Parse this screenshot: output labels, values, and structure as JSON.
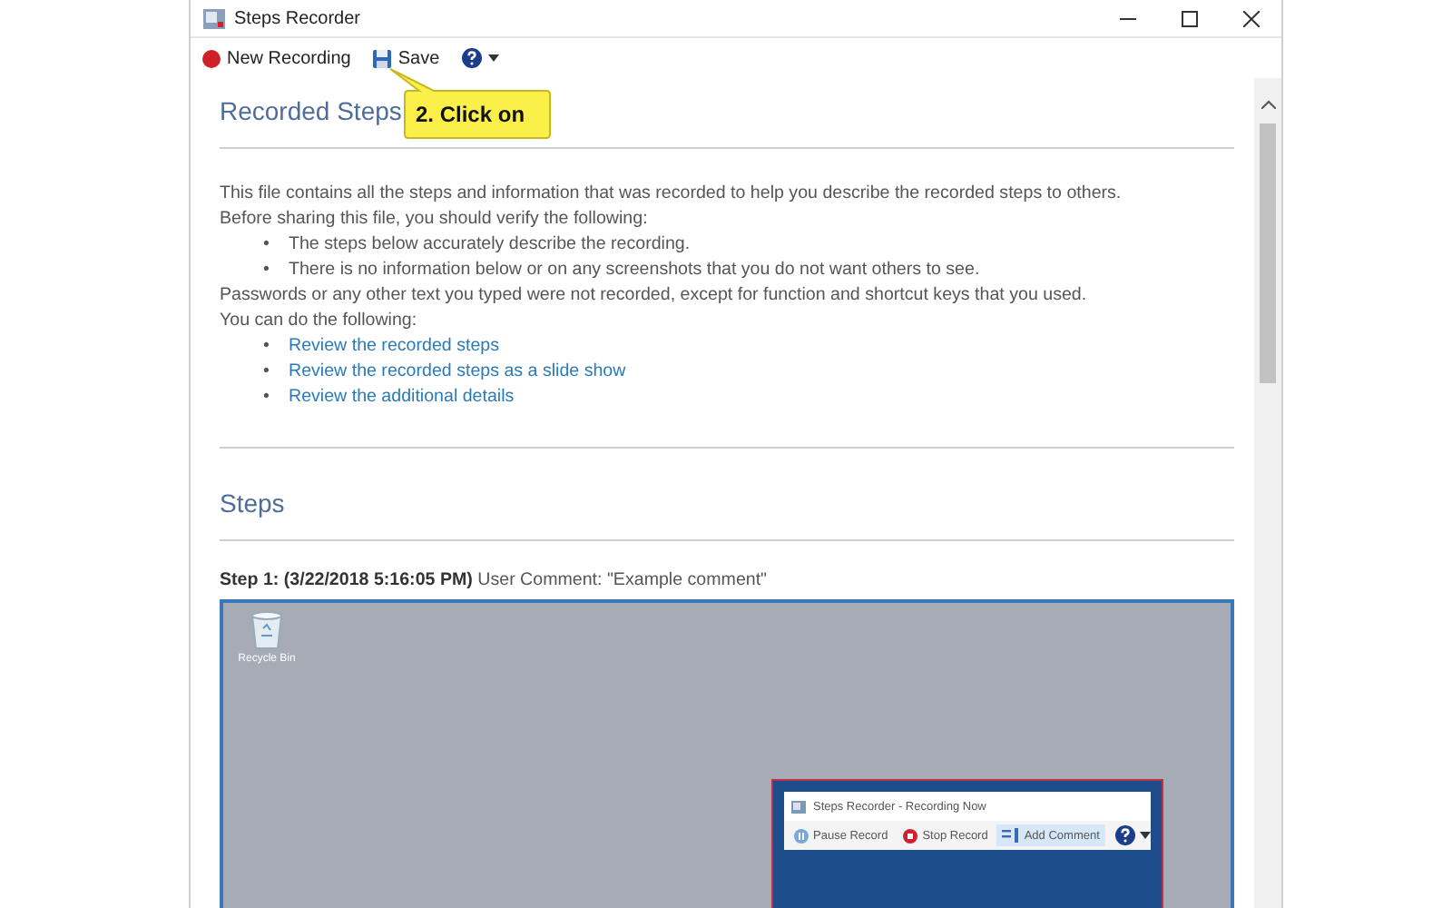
{
  "window": {
    "title": "Steps Recorder"
  },
  "toolbar": [
    {
      "kind": "record",
      "label": "New Recording"
    },
    {
      "kind": "save",
      "label": "Save"
    },
    {
      "kind": "help"
    }
  ],
  "callout": {
    "text": "2. Click on"
  },
  "intro": {
    "heading": "Recorded Steps",
    "blocks": [
      {
        "kind": "text",
        "text": "This file contains all the steps and information that was recorded to help you describe the recorded steps to others."
      },
      {
        "kind": "text",
        "text": "Before sharing this file, you should verify the following:"
      },
      {
        "kind": "bullets",
        "marker": "•",
        "items": [
          "The steps below accurately describe the recording.",
          "There is no information below or on any screenshots that you do not want others to see."
        ]
      },
      {
        "kind": "text",
        "text": "Passwords or any other text you typed were not recorded, except for function and shortcut keys that you used."
      },
      {
        "kind": "text",
        "text": "You can do the following:"
      },
      {
        "kind": "links",
        "marker": "•",
        "items": [
          "Review the recorded steps",
          "Review the recorded steps as a slide show",
          "Review the additional details"
        ]
      }
    ]
  },
  "steps": {
    "heading": "Steps",
    "items": [
      {
        "title": "Step 1: (3/22/2018 5:16:05 PM)",
        "comment": "User Comment: \"Example comment\"",
        "screenshot": {
          "desktop_icons": [
            {
              "label": "Recycle Bin"
            }
          ],
          "window": {
            "title": "Steps Recorder - Recording Now",
            "buttons": [
              {
                "kind": "pause",
                "label": "Pause Record",
                "selected": false
              },
              {
                "kind": "stop",
                "label": "Stop Record",
                "selected": false
              },
              {
                "kind": "comment",
                "label": "Add Comment",
                "selected": true
              },
              {
                "kind": "help",
                "selected": false
              }
            ]
          }
        }
      }
    ]
  }
}
